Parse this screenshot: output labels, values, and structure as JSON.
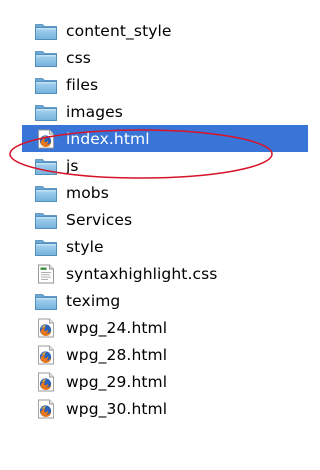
{
  "files": [
    {
      "name": "content_style",
      "type": "folder",
      "icon": "folder-icon"
    },
    {
      "name": "css",
      "type": "folder",
      "icon": "folder-icon"
    },
    {
      "name": "files",
      "type": "folder",
      "icon": "folder-icon"
    },
    {
      "name": "images",
      "type": "folder",
      "icon": "folder-icon"
    },
    {
      "name": "index.html",
      "type": "html",
      "icon": "firefox-html-file-icon",
      "selected": true
    },
    {
      "name": "js",
      "type": "folder",
      "icon": "folder-icon"
    },
    {
      "name": "mobs",
      "type": "folder",
      "icon": "folder-icon"
    },
    {
      "name": "Services",
      "type": "folder",
      "icon": "folder-icon"
    },
    {
      "name": "style",
      "type": "folder",
      "icon": "folder-icon"
    },
    {
      "name": "syntaxhighlight.css",
      "type": "css",
      "icon": "css-file-icon"
    },
    {
      "name": "teximg",
      "type": "folder",
      "icon": "folder-icon"
    },
    {
      "name": "wpg_24.html",
      "type": "html",
      "icon": "firefox-html-file-icon"
    },
    {
      "name": "wpg_28.html",
      "type": "html",
      "icon": "firefox-html-file-icon"
    },
    {
      "name": "wpg_29.html",
      "type": "html",
      "icon": "firefox-html-file-icon"
    },
    {
      "name": "wpg_30.html",
      "type": "html",
      "icon": "firefox-html-file-icon"
    }
  ],
  "colors": {
    "selection": "#3875d7",
    "annotation": "#d8132a",
    "folder": "#8ec3e6"
  }
}
